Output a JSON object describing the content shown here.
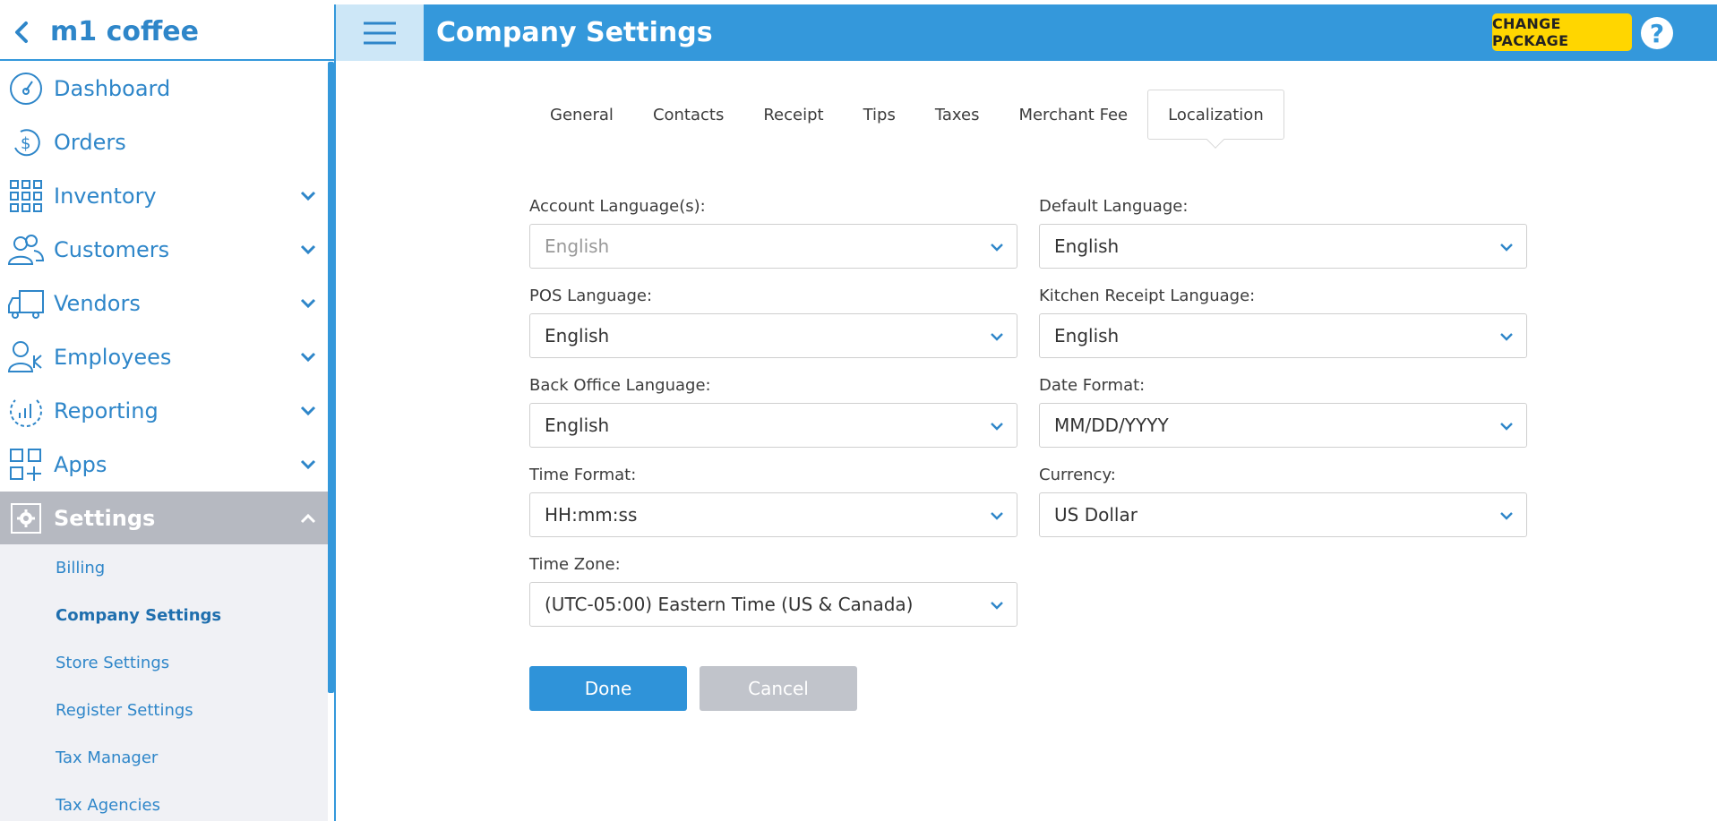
{
  "brand": {
    "title": "m1 coffee"
  },
  "header": {
    "title": "Company Settings",
    "change_package": "CHANGE PACKAGE",
    "help": "?"
  },
  "sidebar": {
    "items": [
      {
        "label": "Dashboard",
        "icon": "gauge-icon",
        "expandable": false
      },
      {
        "label": "Orders",
        "icon": "dollar-cycle-icon",
        "expandable": false
      },
      {
        "label": "Inventory",
        "icon": "grid-icon",
        "expandable": true
      },
      {
        "label": "Customers",
        "icon": "users-icon",
        "expandable": true
      },
      {
        "label": "Vendors",
        "icon": "truck-icon",
        "expandable": true
      },
      {
        "label": "Employees",
        "icon": "employee-icon",
        "expandable": true
      },
      {
        "label": "Reporting",
        "icon": "chart-circle-icon",
        "expandable": true
      },
      {
        "label": "Apps",
        "icon": "apps-icon",
        "expandable": true
      },
      {
        "label": "Settings",
        "icon": "gear-icon",
        "expandable": true,
        "active": true
      }
    ],
    "settings_sub": [
      {
        "label": "Billing"
      },
      {
        "label": "Company Settings",
        "current": true
      },
      {
        "label": "Store Settings"
      },
      {
        "label": "Register Settings"
      },
      {
        "label": "Tax Manager"
      },
      {
        "label": "Tax Agencies"
      }
    ]
  },
  "tabs": [
    {
      "label": "General"
    },
    {
      "label": "Contacts"
    },
    {
      "label": "Receipt"
    },
    {
      "label": "Tips"
    },
    {
      "label": "Taxes"
    },
    {
      "label": "Merchant Fee"
    },
    {
      "label": "Localization",
      "selected": true
    }
  ],
  "form": {
    "account_language": {
      "label": "Account Language(s):",
      "value": "English"
    },
    "default_language": {
      "label": "Default Language:",
      "value": "English"
    },
    "pos_language": {
      "label": "POS Language:",
      "value": "English"
    },
    "kitchen_receipt_language": {
      "label": "Kitchen Receipt Language:",
      "value": "English"
    },
    "back_office_language": {
      "label": "Back Office Language:",
      "value": "English"
    },
    "date_format": {
      "label": "Date Format:",
      "value": "MM/DD/YYYY"
    },
    "time_format": {
      "label": "Time Format:",
      "value": "HH:mm:ss"
    },
    "currency": {
      "label": "Currency:",
      "value": "US Dollar"
    },
    "time_zone": {
      "label": "Time Zone:",
      "value": "(UTC-05:00) Eastern Time (US & Canada)"
    }
  },
  "actions": {
    "done": "Done",
    "cancel": "Cancel"
  },
  "colors": {
    "primary": "#3498db",
    "accent_yellow": "#ffd600",
    "active_nav": "#b6b9c1"
  }
}
